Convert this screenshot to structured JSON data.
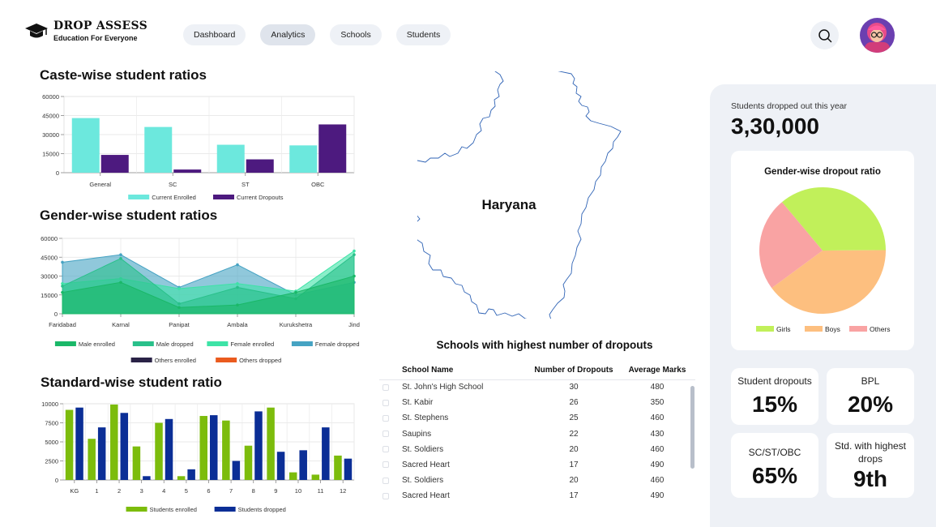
{
  "brand": {
    "name": "DROP ASSESS",
    "tagline": "Education For Everyone"
  },
  "nav": [
    {
      "label": "Dashboard",
      "active": false
    },
    {
      "label": "Analytics",
      "active": true
    },
    {
      "label": "Schools",
      "active": false
    },
    {
      "label": "Students",
      "active": false
    }
  ],
  "icons": {
    "search": "search-icon",
    "avatar": "user-avatar",
    "logo": "graduation-cap-icon"
  },
  "colors": {
    "enrolled_bar": "#6ce8dd",
    "dropout_bar": "#4d1a7f",
    "std_enrolled": "#7cbc0c",
    "std_dropped": "#0b2e96",
    "girls": "#c1f05a",
    "boys": "#fdbf7f",
    "others": "#f9a3a3"
  },
  "titles": {
    "caste": "Caste-wise student ratios",
    "gender": "Gender-wise student ratios",
    "standard": "Standard-wise student ratio"
  },
  "map": {
    "label": "Haryana"
  },
  "chart_data": [
    {
      "type": "bar",
      "title": "Caste-wise student ratios",
      "categories": [
        "General",
        "SC",
        "ST",
        "OBC"
      ],
      "y_ticks": [
        0,
        15000,
        30000,
        45000,
        60000
      ],
      "ylim": [
        0,
        60000
      ],
      "grid": true,
      "legend_position": "bottom",
      "series": [
        {
          "name": "Current Enrolled",
          "color": "#6ce8dd",
          "values": [
            43000,
            36000,
            22000,
            21500
          ]
        },
        {
          "name": "Current Dropouts",
          "color": "#4d1a7f",
          "values": [
            14000,
            2500,
            10500,
            38000
          ]
        }
      ]
    },
    {
      "type": "area",
      "title": "Gender-wise student ratios",
      "categories": [
        "Faridabad",
        "Karnal",
        "Panipat",
        "Ambala",
        "Kurukshetra",
        "Jind"
      ],
      "y_ticks": [
        0,
        15000,
        30000,
        45000,
        60000
      ],
      "ylim": [
        0,
        60000
      ],
      "grid": true,
      "legend_position": "bottom",
      "series": [
        {
          "name": "Male enrolled",
          "color": "#1ab868",
          "values": [
            17000,
            25000,
            5000,
            7000,
            17000,
            30000
          ]
        },
        {
          "name": "Male dropped",
          "color": "#29c08a",
          "values": [
            22000,
            44000,
            8000,
            21000,
            12000,
            47000
          ]
        },
        {
          "name": "Female enrolled",
          "color": "#3de3a6",
          "values": [
            24000,
            28000,
            20000,
            24000,
            18000,
            50000
          ]
        },
        {
          "name": "Female dropped",
          "color": "#46a3c3",
          "values": [
            41000,
            47000,
            21000,
            39000,
            15000,
            25000
          ]
        },
        {
          "name": "Others enrolled",
          "color": "#2a2246",
          "values": []
        },
        {
          "name": "Others dropped",
          "color": "#ea5b1e",
          "values": []
        }
      ]
    },
    {
      "type": "bar",
      "title": "Standard-wise student ratio",
      "categories": [
        "KG",
        "1",
        "2",
        "3",
        "4",
        "5",
        "6",
        "7",
        "8",
        "9",
        "10",
        "11",
        "12"
      ],
      "y_ticks": [
        0,
        2500,
        5000,
        7500,
        10000
      ],
      "ylim": [
        0,
        10000
      ],
      "grid": true,
      "legend_position": "bottom",
      "series": [
        {
          "name": "Students enrolled",
          "color": "#7cbc0c",
          "values": [
            9200,
            5400,
            9900,
            4400,
            7500,
            500,
            8400,
            7800,
            4500,
            9500,
            1000,
            700,
            3200
          ]
        },
        {
          "name": "Students dropped",
          "color": "#0b2e96",
          "values": [
            9500,
            6900,
            8800,
            500,
            8000,
            1400,
            8500,
            2500,
            9000,
            3700,
            3900,
            6900,
            2800
          ]
        }
      ]
    },
    {
      "type": "pie",
      "title": "Gender-wise dropout ratio",
      "legend_position": "bottom",
      "labels": [
        "Girls",
        "Boys",
        "Others"
      ],
      "values": [
        36,
        40,
        24
      ],
      "colors": [
        "#c1f05a",
        "#fdbf7f",
        "#f9a3a3"
      ]
    }
  ],
  "table": {
    "title": "Schools with highest number of dropouts",
    "columns": [
      "School Name",
      "Number of Dropouts",
      "Average Marks"
    ],
    "rows": [
      [
        "St. John's High School",
        "30",
        "480"
      ],
      [
        "St. Kabir",
        "26",
        "350"
      ],
      [
        "St. Stephens",
        "25",
        "460"
      ],
      [
        "Saupins",
        "22",
        "430"
      ],
      [
        "St. Soldiers",
        "20",
        "460"
      ],
      [
        "Sacred Heart",
        "17",
        "490"
      ],
      [
        "St. Soldiers",
        "20",
        "460"
      ],
      [
        "Sacred Heart",
        "17",
        "490"
      ]
    ]
  },
  "summary": {
    "dropped_label": "Students dropped out this year",
    "dropped_value": "3,30,000",
    "stats": [
      {
        "label": "Student dropouts",
        "value": "15%"
      },
      {
        "label": "BPL",
        "value": "20%"
      },
      {
        "label": "SC/ST/OBC",
        "value": "65%"
      },
      {
        "label": "Std. with highest drops",
        "value": "9th"
      }
    ]
  }
}
